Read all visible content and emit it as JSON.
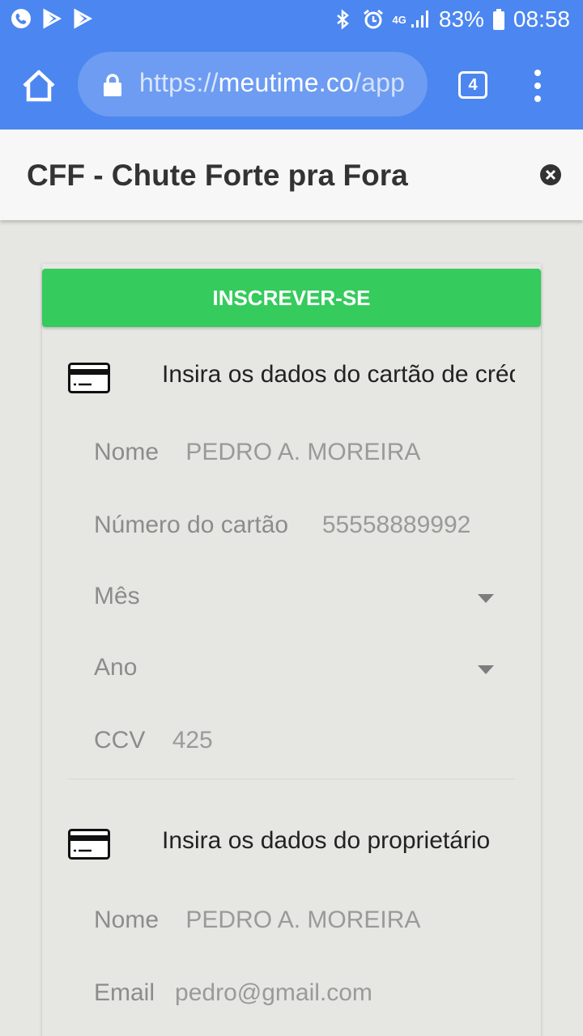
{
  "status_bar": {
    "battery": "83%",
    "time": "08:58",
    "network": "4G"
  },
  "browser": {
    "url_scheme": "https://",
    "url_host": "meutime.co",
    "url_path": "/app",
    "tab_count": "4"
  },
  "header": {
    "title": "CFF - Chute Forte pra Fora"
  },
  "card": {
    "subscribe_label": "INSCREVER-SE",
    "card_section": {
      "heading": "Insira os dados do cartão de crédito",
      "name_label": "Nome",
      "name_value": "PEDRO A. MOREIRA",
      "number_label": "Número do cartão",
      "number_value": "55558889992",
      "month_label": "Mês",
      "year_label": "Ano",
      "ccv_label": "CCV",
      "ccv_value": "425"
    },
    "owner_section": {
      "heading": "Insira os dados do proprietário",
      "name_label": "Nome",
      "name_value": "PEDRO A. MOREIRA",
      "email_label": "Email",
      "email_value": "pedro@gmail.com"
    }
  },
  "colors": {
    "browser_bar": "#4c86f0",
    "subscribe_green": "#35cb5d",
    "background": "#e6e6e2"
  },
  "icons": [
    "phone-icon",
    "play-store-icon",
    "play-store-icon",
    "bluetooth-icon",
    "alarm-icon",
    "signal-icon",
    "battery-icon",
    "home-icon",
    "lock-icon",
    "tabs-icon",
    "more-icon",
    "close-icon",
    "credit-card-icon"
  ]
}
